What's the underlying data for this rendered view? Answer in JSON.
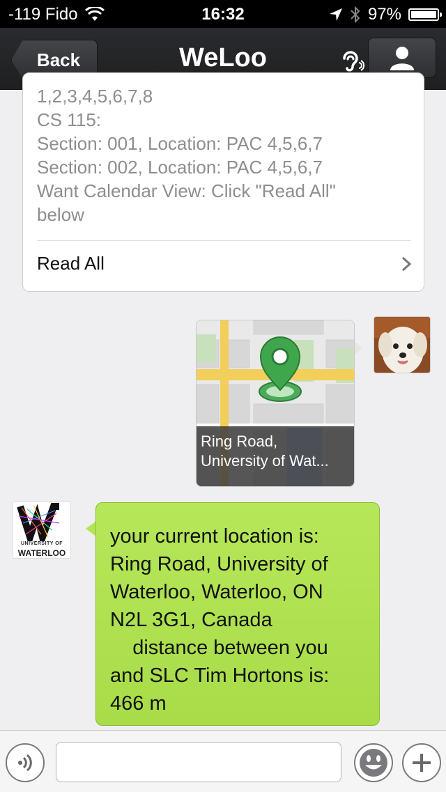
{
  "status_bar": {
    "carrier": "-119 Fido",
    "time": "16:32",
    "battery": "97%"
  },
  "nav": {
    "back_label": "Back",
    "title": "WeLoo"
  },
  "card": {
    "lines": [
      "1,2,3,4,5,6,7,8",
      "CS 115:",
      "Section: 001, Location: PAC 4,5,6,7",
      "Section: 002, Location: PAC 4,5,6,7",
      "Want Calendar View: Click \"Read All\"",
      "below"
    ],
    "read_all_label": "Read All"
  },
  "map_message": {
    "caption_lines": [
      "Ring Road,",
      "University of Wat..."
    ]
  },
  "uw_avatar": {
    "small_text": "UNIVERSITY OF",
    "big_text": "WATERLOO"
  },
  "reply_message": {
    "lines": [
      "your current location is:",
      "Ring Road, University of",
      "Waterloo, Waterloo, ON",
      "N2L 3G1, Canada",
      "    distance between you",
      "and SLC Tim Hortons is:",
      "466 m"
    ]
  },
  "toolbar": {
    "input_placeholder": ""
  },
  "icons": {
    "wifi": "wifi-icon",
    "location": "location-arrow-icon",
    "bluetooth": "bluetooth-icon",
    "ear": "ear-icon",
    "profile": "person-icon",
    "voice": "voice-icon",
    "emoji": "emoji-icon",
    "plus": "plus-icon"
  },
  "colors": {
    "bubble_green": "#b2e455",
    "nav_dark": "#252629"
  }
}
